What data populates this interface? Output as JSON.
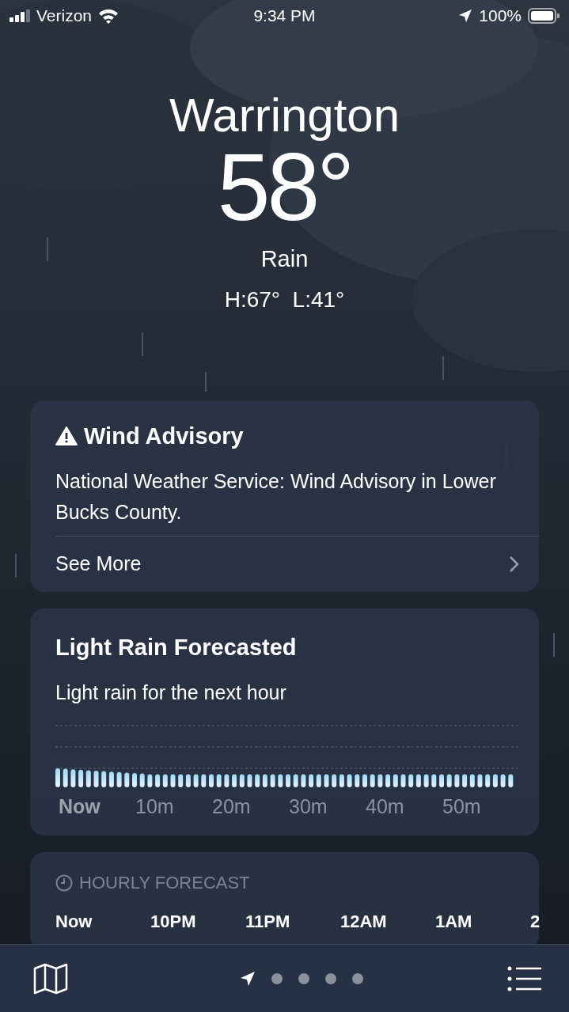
{
  "status_bar": {
    "carrier": "Verizon",
    "time": "9:34 PM",
    "battery": "100%"
  },
  "header": {
    "city": "Warrington",
    "temperature": "58°",
    "condition": "Rain",
    "high_low": "H:67°  L:41°"
  },
  "advisory": {
    "title": "Wind Advisory",
    "text": "National Weather Service: Wind Advisory in Lower Bucks County.",
    "link": "See More"
  },
  "precipitation": {
    "title": "Light Rain Forecasted",
    "subtitle": "Light rain for the next hour",
    "axis_labels": [
      {
        "label": "Now",
        "selected": true
      },
      {
        "label": "10m",
        "selected": false
      },
      {
        "label": "20m",
        "selected": false
      },
      {
        "label": "30m",
        "selected": false
      },
      {
        "label": "40m",
        "selected": false
      },
      {
        "label": "50m",
        "selected": false
      }
    ]
  },
  "hourly": {
    "title": "HOURLY FORECAST",
    "hours": [
      "Now",
      "10PM",
      "11PM",
      "12AM",
      "1AM",
      "2"
    ]
  },
  "page_indicator": [
    {
      "kind": "location",
      "selected": true
    },
    {
      "kind": "dot",
      "selected": false
    },
    {
      "kind": "dot",
      "selected": false
    },
    {
      "kind": "dot",
      "selected": false
    },
    {
      "kind": "dot",
      "selected": false
    }
  ]
}
